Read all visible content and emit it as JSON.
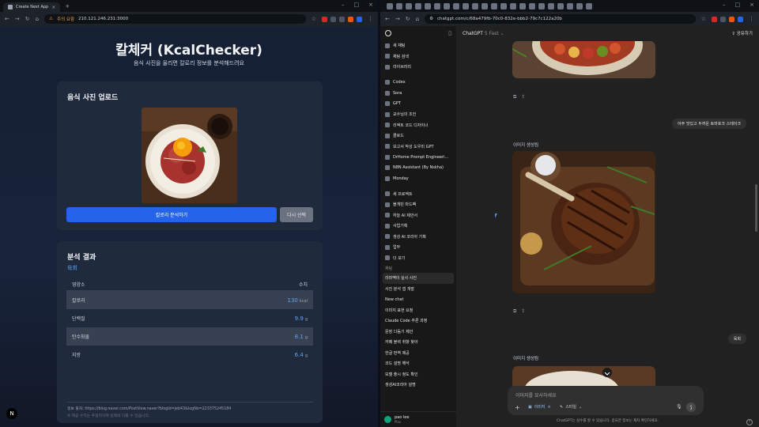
{
  "left_browser": {
    "tab_title": "Create Next App",
    "url_warning": "주의 요함",
    "url": "210.121.246.231:3000",
    "app": {
      "title": "칼체커 (KcalChecker)",
      "subtitle": "음식 사진을 올리면 칼로리 정보를 분석해드려요",
      "upload_heading": "음식 사진 업로드",
      "analyze_button": "칼로리 분석하기",
      "reselect_button": "다시 선택",
      "result_heading": "분석 결과",
      "food_name": "육회",
      "table_header": {
        "nutrient": "영양소",
        "value": "수치"
      },
      "rows": [
        {
          "name": "칼로리",
          "value": "130",
          "unit": "kcal"
        },
        {
          "name": "단백질",
          "value": "9.9",
          "unit": "g"
        },
        {
          "name": "탄수화물",
          "value": "8.1",
          "unit": "g"
        },
        {
          "name": "지방",
          "value": "6.4",
          "unit": "g"
        }
      ],
      "source": "정보 출처: https://blog.naver.com/PostView.naver?blogId=jeb43&logNo=223375245184",
      "note": "※ 제공 수치는 추정치이며 실제와 다를 수 있습니다.",
      "badge": "N"
    }
  },
  "right_browser": {
    "url": "chatgpt.com/c/68a479fb-70c0-832e-bbb2-79c7c122a20b",
    "sidebar": {
      "top_items": [
        "새 채팅",
        "채팅 검색",
        "라이브러리"
      ],
      "gpt_items": [
        "Codex",
        "Sora",
        "GPT",
        "교수님의 조언",
        "리액트 코드 디자이너",
        "클로드",
        "보고서 작성 도우미 GPT",
        "DrHome Prompt Engineeri...",
        "N8N Assistant (By Nskha)",
        "Monday"
      ],
      "project_items": [
        "새 프로젝트",
        "블개빈 마드팩",
        "하늘 AI 제안서",
        "사업기획",
        "생성 AI 코리아 기획",
        "업무",
        "더 보기"
      ],
      "chats_label": "채팅",
      "chat_items": [
        "라마맥이 실사 사진",
        "사진 분석 앱 개발",
        "New chat",
        "이미지 표현 요청",
        "Claude Code 추론 과정",
        "문장 다듬기 제안",
        "카페 블렉 취향 찾아",
        "한글 번역 제공",
        "코드 설명 해석",
        "모델 출시 정도 확인",
        "생성AI코리아 설명"
      ],
      "user_name": "pao lee",
      "user_plan": "Plus"
    },
    "header": {
      "model": "ChatGPT",
      "model_sub": "5 Fast",
      "share": "공유하기"
    },
    "chat": {
      "user_msg_1": "아주 맛있고 두꺼운 토마호크 스테이크",
      "gen_label_1": "이미지 생성됨",
      "user_msg_2": "육회",
      "gen_label_2": "이미지 생성됨"
    },
    "composer": {
      "placeholder": "이미지를 묘사하세요",
      "image_pill": "이미지",
      "style_pill": "스타일"
    },
    "disclaimer": "ChatGPT는 실수를 할 수 있습니다. 중요한 정보는 재차 확인하세요."
  }
}
